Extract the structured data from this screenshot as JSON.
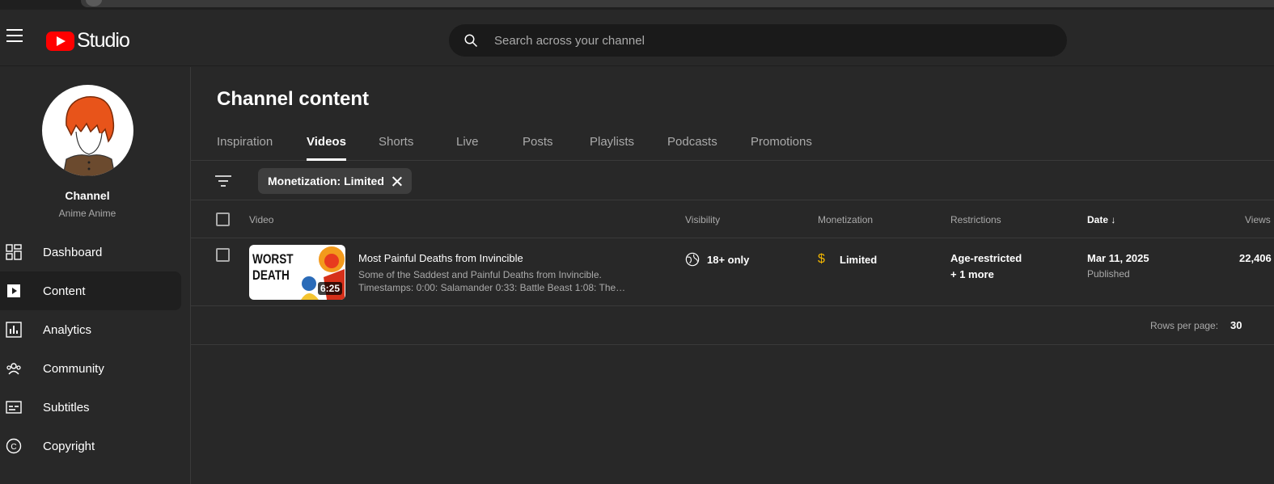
{
  "header": {
    "logo_text": "Studio",
    "search": {
      "placeholder": "Search across your channel"
    }
  },
  "sidebar": {
    "channel_name": "Channel",
    "channel_handle": "Anime Anime",
    "items": [
      {
        "label": "Dashboard",
        "icon": "dashboard-icon"
      },
      {
        "label": "Content",
        "icon": "content-icon",
        "active": true
      },
      {
        "label": "Analytics",
        "icon": "analytics-icon"
      },
      {
        "label": "Community",
        "icon": "community-icon"
      },
      {
        "label": "Subtitles",
        "icon": "subtitles-icon"
      },
      {
        "label": "Copyright",
        "icon": "copyright-icon"
      }
    ]
  },
  "main": {
    "title": "Channel content",
    "tabs": [
      "Inspiration",
      "Videos",
      "Shorts",
      "Live",
      "Posts",
      "Playlists",
      "Podcasts",
      "Promotions"
    ],
    "active_tab": "Videos",
    "filter_chip": "Monetization: Limited",
    "columns": {
      "video": "Video",
      "visibility": "Visibility",
      "monetization": "Monetization",
      "restrictions": "Restrictions",
      "date": "Date",
      "views": "Views"
    },
    "rows": [
      {
        "thumb_text_1": "WORST",
        "thumb_text_2": "DEATH",
        "duration": "6:25",
        "title": "Most Painful Deaths from Invincible",
        "description": "Some of the Saddest and Painful Deaths from Invincible. Timestamps: 0:00: Salamander 0:33: Battle Beast 1:08: The…",
        "visibility": "18+ only",
        "monetization": "Limited",
        "restriction": "Age-restricted",
        "restriction_more": "+ 1 more",
        "date": "Mar 11, 2025",
        "date_status": "Published",
        "views": "22,406"
      }
    ],
    "pager": {
      "rows_per_page_label": "Rows per page:",
      "rows_per_page": "30"
    }
  },
  "colors": {
    "accent": "#ff0000",
    "monetization_limited": "#f2b600",
    "bg": "#282828"
  }
}
